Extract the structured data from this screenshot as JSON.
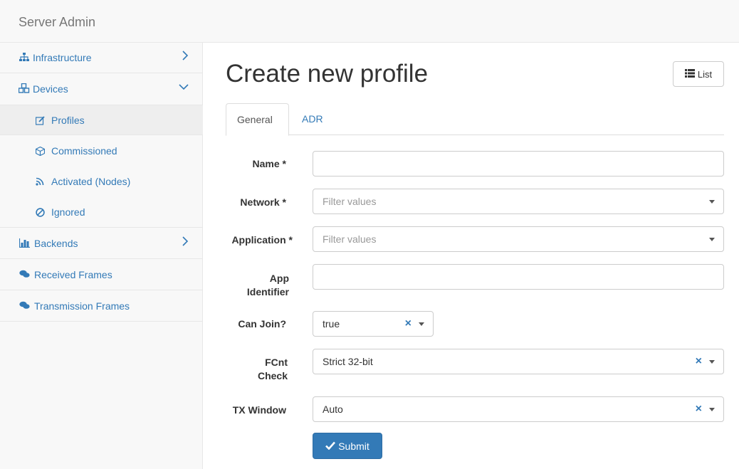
{
  "app": {
    "brand": "Server Admin"
  },
  "sidebar": {
    "items": [
      {
        "label": "Infrastructure",
        "icon": "sitemap-icon",
        "chevron": "chevron-right-icon"
      },
      {
        "label": "Devices",
        "icon": "cubes-icon",
        "chevron": "chevron-down-icon"
      },
      {
        "label": "Backends",
        "icon": "bar-chart-icon",
        "chevron": "chevron-right-icon"
      },
      {
        "label": "Received Frames",
        "icon": "comments-icon"
      },
      {
        "label": "Transmission Frames",
        "icon": "comments-icon"
      }
    ],
    "devices_sub": [
      {
        "label": "Profiles",
        "icon": "edit-icon",
        "active": true
      },
      {
        "label": "Commissioned",
        "icon": "cube-icon"
      },
      {
        "label": "Activated (Nodes)",
        "icon": "rss-icon"
      },
      {
        "label": "Ignored",
        "icon": "ban-icon"
      }
    ]
  },
  "main": {
    "title": "Create new profile",
    "list_button": "List",
    "tabs": [
      {
        "label": "General",
        "active": true
      },
      {
        "label": "ADR",
        "active": false
      }
    ],
    "form": {
      "name": {
        "label": "Name *",
        "value": ""
      },
      "network": {
        "label": "Network *",
        "placeholder": "Filter values"
      },
      "application": {
        "label": "Application *",
        "placeholder": "Filter values"
      },
      "app_identifier": {
        "label_line1": "App",
        "label_line2": "Identifier",
        "value": ""
      },
      "can_join": {
        "label": "Can Join?",
        "value": "true"
      },
      "fcnt_check": {
        "label_line1": "FCnt",
        "label_line2": "Check",
        "value": "Strict 32-bit"
      },
      "tx_window": {
        "label": "TX Window",
        "value": "Auto"
      }
    },
    "submit_label": "Submit"
  },
  "colors": {
    "accent": "#337ab7",
    "sidebar_bg": "#f8f8f8",
    "active_bg": "#eeeeee"
  }
}
